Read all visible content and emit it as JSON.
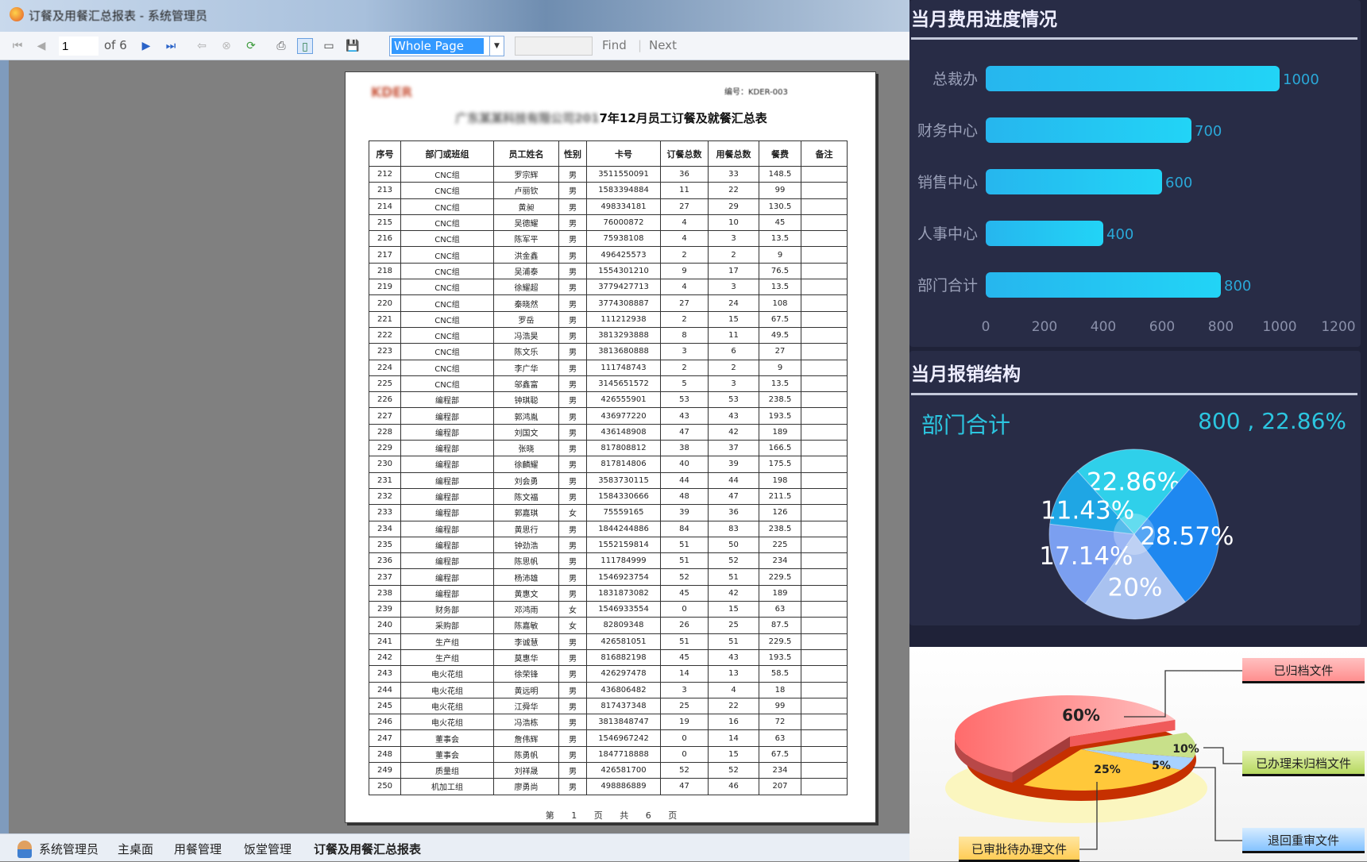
{
  "window": {
    "title": "订餐及用餐汇总报表 - 系统管理员"
  },
  "toolbar": {
    "page_current": "1",
    "page_of": "of 6",
    "zoom_value": "Whole Page",
    "find_label": "Find",
    "next_label": "Next",
    "find_value": ""
  },
  "report": {
    "logo_text": "KDER",
    "code": "编号：KDER-003",
    "title_blurred": "广东某某科技有限公司201",
    "title": "7年12月员工订餐及就餐汇总表",
    "columns": [
      "序号",
      "部门或班组",
      "员工姓名",
      "性别",
      "卡号",
      "订餐总数",
      "用餐总数",
      "餐费",
      "备注"
    ],
    "rows": [
      [
        "212",
        "CNC组",
        "罗宗辉",
        "男",
        "3511550091",
        "36",
        "33",
        "148.5",
        ""
      ],
      [
        "213",
        "CNC组",
        "卢丽钦",
        "男",
        "1583394884",
        "11",
        "22",
        "99",
        ""
      ],
      [
        "214",
        "CNC组",
        "黄昶",
        "男",
        "498334181",
        "27",
        "29",
        "130.5",
        ""
      ],
      [
        "215",
        "CNC组",
        "吴德耀",
        "男",
        "76000872",
        "4",
        "10",
        "45",
        ""
      ],
      [
        "216",
        "CNC组",
        "陈军平",
        "男",
        "75938108",
        "4",
        "3",
        "13.5",
        ""
      ],
      [
        "217",
        "CNC组",
        "洪金鑫",
        "男",
        "496425573",
        "2",
        "2",
        "9",
        ""
      ],
      [
        "218",
        "CNC组",
        "吴浦泰",
        "男",
        "1554301210",
        "9",
        "17",
        "76.5",
        ""
      ],
      [
        "219",
        "CNC组",
        "徐耀超",
        "男",
        "3779427713",
        "4",
        "3",
        "13.5",
        ""
      ],
      [
        "220",
        "CNC组",
        "秦晓然",
        "男",
        "3774308887",
        "27",
        "24",
        "108",
        ""
      ],
      [
        "221",
        "CNC组",
        "罗岳",
        "男",
        "111212938",
        "2",
        "15",
        "67.5",
        ""
      ],
      [
        "222",
        "CNC组",
        "冯浩昊",
        "男",
        "3813293888",
        "8",
        "11",
        "49.5",
        ""
      ],
      [
        "223",
        "CNC组",
        "陈文乐",
        "男",
        "3813680888",
        "3",
        "6",
        "27",
        ""
      ],
      [
        "224",
        "CNC组",
        "李广华",
        "男",
        "111748743",
        "2",
        "2",
        "9",
        ""
      ],
      [
        "225",
        "CNC组",
        "邬鑫富",
        "男",
        "3145651572",
        "5",
        "3",
        "13.5",
        ""
      ],
      [
        "226",
        "编程部",
        "钟琪聪",
        "男",
        "426555901",
        "53",
        "53",
        "238.5",
        ""
      ],
      [
        "227",
        "编程部",
        "郭鸿胤",
        "男",
        "436977220",
        "43",
        "43",
        "193.5",
        ""
      ],
      [
        "228",
        "编程部",
        "刘国文",
        "男",
        "436148908",
        "47",
        "42",
        "189",
        ""
      ],
      [
        "229",
        "编程部",
        "张晓",
        "男",
        "817808812",
        "38",
        "37",
        "166.5",
        ""
      ],
      [
        "230",
        "编程部",
        "徐麟耀",
        "男",
        "817814806",
        "40",
        "39",
        "175.5",
        ""
      ],
      [
        "231",
        "编程部",
        "刘会勇",
        "男",
        "3583730115",
        "44",
        "44",
        "198",
        ""
      ],
      [
        "232",
        "编程部",
        "陈文福",
        "男",
        "1584330666",
        "48",
        "47",
        "211.5",
        ""
      ],
      [
        "233",
        "编程部",
        "郭嘉琪",
        "女",
        "75559165",
        "39",
        "36",
        "126",
        ""
      ],
      [
        "234",
        "编程部",
        "黄思行",
        "男",
        "1844244886",
        "84",
        "83",
        "238.5",
        ""
      ],
      [
        "235",
        "编程部",
        "钟劲浩",
        "男",
        "1552159814",
        "51",
        "50",
        "225",
        ""
      ],
      [
        "236",
        "编程部",
        "陈思帆",
        "男",
        "111784999",
        "51",
        "52",
        "234",
        ""
      ],
      [
        "237",
        "编程部",
        "杨沛雄",
        "男",
        "1546923754",
        "52",
        "51",
        "229.5",
        ""
      ],
      [
        "238",
        "编程部",
        "黄惠文",
        "男",
        "1831873082",
        "45",
        "42",
        "189",
        ""
      ],
      [
        "239",
        "财务部",
        "邓鸿雨",
        "女",
        "1546933554",
        "0",
        "15",
        "63",
        ""
      ],
      [
        "240",
        "采购部",
        "陈嘉敏",
        "女",
        "82809348",
        "26",
        "25",
        "87.5",
        ""
      ],
      [
        "241",
        "生产组",
        "李诚慧",
        "男",
        "426581051",
        "51",
        "51",
        "229.5",
        ""
      ],
      [
        "242",
        "生产组",
        "莫惠华",
        "男",
        "816882198",
        "45",
        "43",
        "193.5",
        ""
      ],
      [
        "243",
        "电火花组",
        "徐荣锋",
        "男",
        "426297478",
        "14",
        "13",
        "58.5",
        ""
      ],
      [
        "244",
        "电火花组",
        "黄远明",
        "男",
        "436806482",
        "3",
        "4",
        "18",
        ""
      ],
      [
        "245",
        "电火花组",
        "江舜华",
        "男",
        "817437348",
        "25",
        "22",
        "99",
        ""
      ],
      [
        "246",
        "电火花组",
        "冯浩栋",
        "男",
        "3813848747",
        "19",
        "16",
        "72",
        ""
      ],
      [
        "247",
        "董事会",
        "詹伟辉",
        "男",
        "1546967242",
        "0",
        "14",
        "63",
        ""
      ],
      [
        "248",
        "董事会",
        "陈勇帆",
        "男",
        "1847718888",
        "0",
        "15",
        "67.5",
        ""
      ],
      [
        "249",
        "质量组",
        "刘祥晟",
        "男",
        "426581700",
        "52",
        "52",
        "234",
        ""
      ],
      [
        "250",
        "机加工组",
        "廖勇尚",
        "男",
        "498886889",
        "47",
        "46",
        "207",
        ""
      ]
    ],
    "footer": "第 1 页 共 6 页"
  },
  "statusbar": {
    "items": [
      "系统管理员",
      "主桌面",
      "用餐管理",
      "饭堂管理",
      "订餐及用餐汇总报表"
    ]
  },
  "chart_data": [
    {
      "type": "bar",
      "orientation": "horizontal",
      "title": "当月费用进度情况",
      "categories": [
        "总裁办",
        "财务中心",
        "销售中心",
        "人事中心",
        "部门合计"
      ],
      "values": [
        1000,
        700,
        600,
        400,
        800
      ],
      "xlim": [
        0,
        1200
      ],
      "ticks": [
        "0",
        "200",
        "400",
        "600",
        "800",
        "1000",
        "1200"
      ],
      "color": "#22c8f0",
      "grid": false
    },
    {
      "type": "pie",
      "title": "当月报销结构",
      "highlight": {
        "name": "部门合计",
        "value": "800 , 22.86%"
      },
      "labels": [
        "22.86%",
        "28.57%",
        "20%",
        "17.14%",
        "11.43%"
      ],
      "values": [
        22.86,
        28.57,
        20,
        17.14,
        11.43
      ],
      "colors": [
        "#2fd0ea",
        "#1e88f0",
        "#a9c2f0",
        "#7b9ff0",
        "#1fa6e4"
      ]
    },
    {
      "type": "pie",
      "style": "3d-exploded",
      "categories": [
        "已归档文件",
        "已办理未归档文件",
        "退回重审文件",
        "已审批待办理文件"
      ],
      "labels": [
        "60%",
        "10%",
        "5%",
        "25%"
      ],
      "values": [
        60,
        10,
        5,
        25
      ],
      "colors": [
        "#ff7f7f",
        "#c8e08a",
        "#a8d2ff",
        "#ffc83a"
      ]
    }
  ]
}
